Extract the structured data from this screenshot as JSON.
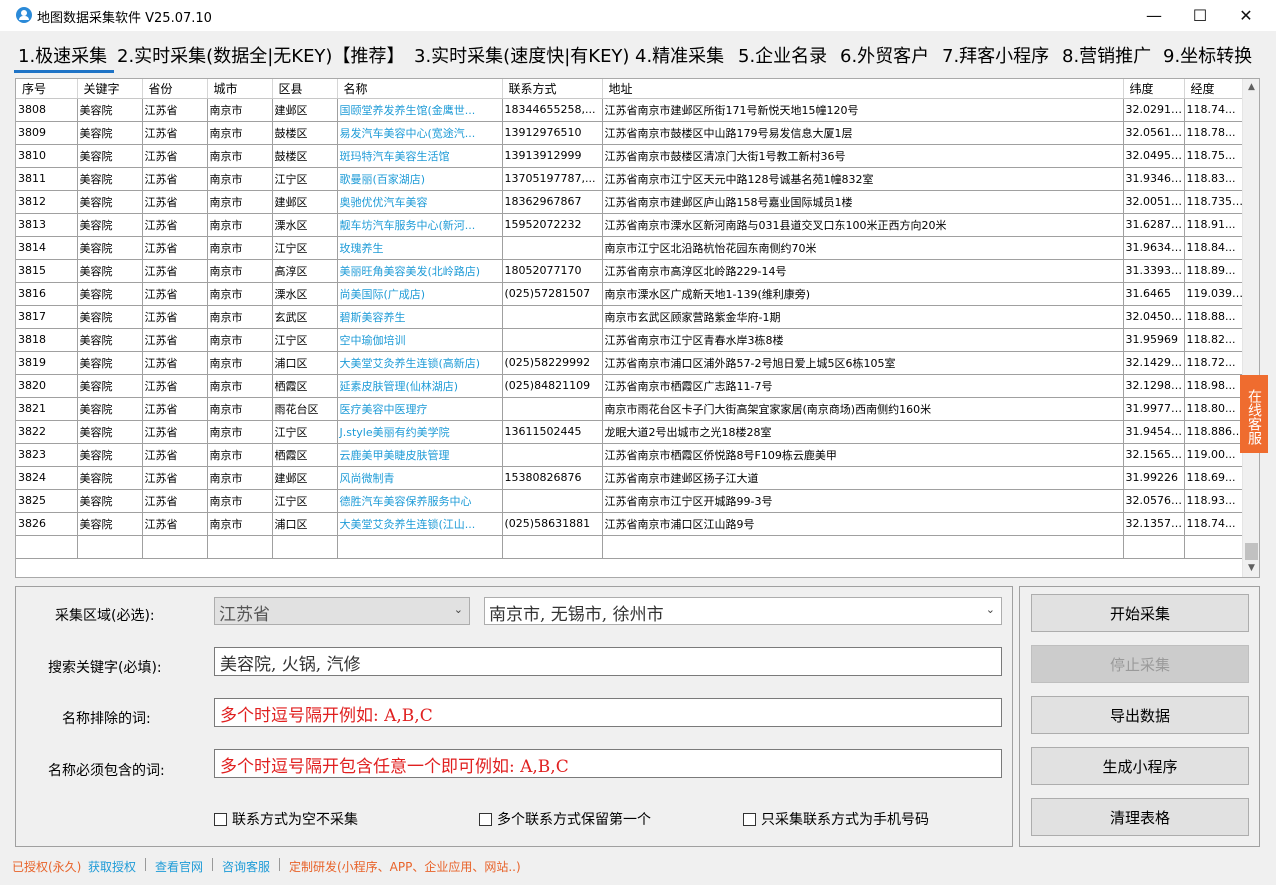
{
  "window": {
    "title": "地图数据采集软件 V25.07.10"
  },
  "menu": {
    "tabs": [
      {
        "label": "1.极速采集"
      },
      {
        "label": "2.实时采集(数据全|无KEY)【推荐】"
      },
      {
        "label": "3.实时采集(速度快|有KEY)"
      },
      {
        "label": "4.精准采集"
      },
      {
        "label": "5.企业名录"
      },
      {
        "label": "6.外贸客户"
      },
      {
        "label": "7.拜客小程序"
      },
      {
        "label": "8.营销推广"
      },
      {
        "label": "9.坐标转换"
      }
    ]
  },
  "table": {
    "columns": [
      "序号",
      "关键字",
      "省份",
      "城市",
      "区县",
      "名称",
      "联系方式",
      "地址",
      "纬度",
      "经度"
    ],
    "rows": [
      [
        "3808",
        "美容院",
        "江苏省",
        "南京市",
        "建邺区",
        "国颐堂养发养生馆(金鹰世...",
        "18344655258,...",
        "江苏省南京市建邺区所街171号新悦天地15幢120号",
        "32.029118",
        "118.74..."
      ],
      [
        "3809",
        "美容院",
        "江苏省",
        "南京市",
        "鼓楼区",
        "易发汽车美容中心(宽途汽...",
        "13912976510",
        "江苏省南京市鼓楼区中山路179号易发信息大厦1层",
        "32.056122",
        "118.78..."
      ],
      [
        "3810",
        "美容院",
        "江苏省",
        "南京市",
        "鼓楼区",
        "斑玛特汽车美容生活馆",
        "13913912999",
        "江苏省南京市鼓楼区清凉门大街1号教工新村36号",
        "32.049573",
        "118.75..."
      ],
      [
        "3811",
        "美容院",
        "江苏省",
        "南京市",
        "江宁区",
        "歌曼丽(百家湖店)",
        "13705197787,...",
        "江苏省南京市江宁区天元中路128号诚基名苑1幢832室",
        "31.934673",
        "118.83..."
      ],
      [
        "3812",
        "美容院",
        "江苏省",
        "南京市",
        "建邺区",
        "奥驰优优汽车美容",
        "18362967867",
        "江苏省南京市建邺区庐山路158号嘉业国际城员1楼",
        "32.005135",
        "118.73517"
      ],
      [
        "3813",
        "美容院",
        "江苏省",
        "南京市",
        "溧水区",
        "靓车坊汽车服务中心(新河...",
        "15952072232",
        "江苏省南京市溧水区新河南路与031县道交叉口东100米正西方向20米",
        "31.628737",
        "118.91..."
      ],
      [
        "3814",
        "美容院",
        "江苏省",
        "南京市",
        "江宁区",
        "玫瑰养生",
        "",
        "南京市江宁区北沿路杭怡花园东南侧约70米",
        "31.963421",
        "118.84..."
      ],
      [
        "3815",
        "美容院",
        "江苏省",
        "南京市",
        "高淳区",
        "美丽旺角美容美发(北岭路店)",
        "18052077170",
        "江苏省南京市高淳区北岭路229-14号",
        "31.339317",
        "118.89..."
      ],
      [
        "3816",
        "美容院",
        "江苏省",
        "南京市",
        "溧水区",
        "尚美国际(广成店)",
        "(025)57281507",
        "南京市溧水区广成新天地1-139(维利康旁)",
        "31.6465",
        "119.03917"
      ],
      [
        "3817",
        "美容院",
        "江苏省",
        "南京市",
        "玄武区",
        "碧斯美容养生",
        "",
        "南京市玄武区顾家营路紫金华府-1期",
        "32.045088",
        "118.88..."
      ],
      [
        "3818",
        "美容院",
        "江苏省",
        "南京市",
        "江宁区",
        "空中瑜伽培训",
        "",
        "江苏省南京市江宁区青春水岸3栋8楼",
        "31.95969",
        "118.82..."
      ],
      [
        "3819",
        "美容院",
        "江苏省",
        "南京市",
        "浦口区",
        "大美堂艾灸养生连锁(高新店)",
        "(025)58229992",
        "江苏省南京市浦口区浦外路57-2号旭日爱上城5区6栋105室",
        "32.142936",
        "118.72..."
      ],
      [
        "3820",
        "美容院",
        "江苏省",
        "南京市",
        "栖霞区",
        "延素皮肤管理(仙林湖店)",
        "(025)84821109",
        "江苏省南京市栖霞区广志路11-7号",
        "32.129817",
        "118.98..."
      ],
      [
        "3821",
        "美容院",
        "江苏省",
        "南京市",
        "雨花台区",
        "医疗美容中医理疗",
        "",
        "南京市雨花台区卡子门大街高架宜家家居(南京商场)西南侧约160米",
        "31.997781",
        "118.80..."
      ],
      [
        "3822",
        "美容院",
        "江苏省",
        "南京市",
        "江宁区",
        "J.style美丽有约美学院",
        "13611502445",
        "龙眠大道2号出城市之光18楼28室",
        "31.945472",
        "118.88672"
      ],
      [
        "3823",
        "美容院",
        "江苏省",
        "南京市",
        "栖霞区",
        "云鹿美甲美睫皮肤管理",
        "",
        "江苏省南京市栖霞区侨悦路8号F109栋云鹿美甲",
        "32.156524",
        "119.00..."
      ],
      [
        "3824",
        "美容院",
        "江苏省",
        "南京市",
        "建邺区",
        "风尚微制青",
        "15380826876",
        "江苏省南京市建邺区扬子江大道",
        "31.99226",
        "118.69..."
      ],
      [
        "3825",
        "美容院",
        "江苏省",
        "南京市",
        "江宁区",
        "德胜汽车美容保养服务中心",
        "",
        "江苏省南京市江宁区开城路99-3号",
        "32.057643",
        "118.93..."
      ],
      [
        "3826",
        "美容院",
        "江苏省",
        "南京市",
        "浦口区",
        "大美堂艾灸养生连锁(江山...",
        "(025)58631881",
        "江苏省南京市浦口区江山路9号",
        "32.135735",
        "118.74..."
      ]
    ]
  },
  "side_tab": {
    "label": "在线客服"
  },
  "form": {
    "region_label": "采集区域(必选):",
    "province_value": "江苏省",
    "cities_value": "南京市, 无锡市, 徐州市",
    "keyword_label": "搜索关键字(必填):",
    "keyword_value": "美容院, 火锅, 汽修",
    "exclude_label": "名称排除的词:",
    "exclude_placeholder": "多个时逗号隔开例如: A,B,C",
    "include_label": "名称必须包含的词:",
    "include_placeholder": "多个时逗号隔开包含任意一个即可例如: A,B,C",
    "checkboxes": [
      {
        "label": "联系方式为空不采集",
        "checked": false
      },
      {
        "label": "多个联系方式保留第一个",
        "checked": false
      },
      {
        "label": "只采集联系方式为手机号码",
        "checked": false
      }
    ]
  },
  "actions": {
    "start": "开始采集",
    "stop": "停止采集",
    "export": "导出数据",
    "miniprogram": "生成小程序",
    "clear": "清理表格"
  },
  "status": {
    "licensed": "已授权(永久)",
    "get_license": "获取授权",
    "website": "查看官网",
    "support": "咨询客服",
    "custom_dev": "定制研发(小程序、APP、企业应用、网站..)"
  },
  "colors": {
    "accent": "#1e73c6",
    "name_link": "#1e9bd7",
    "placeholder_red": "#e02020",
    "side_tab": "#ef6c2f",
    "status_orange": "#e8632a",
    "status_blue": "#1e9bd7"
  }
}
